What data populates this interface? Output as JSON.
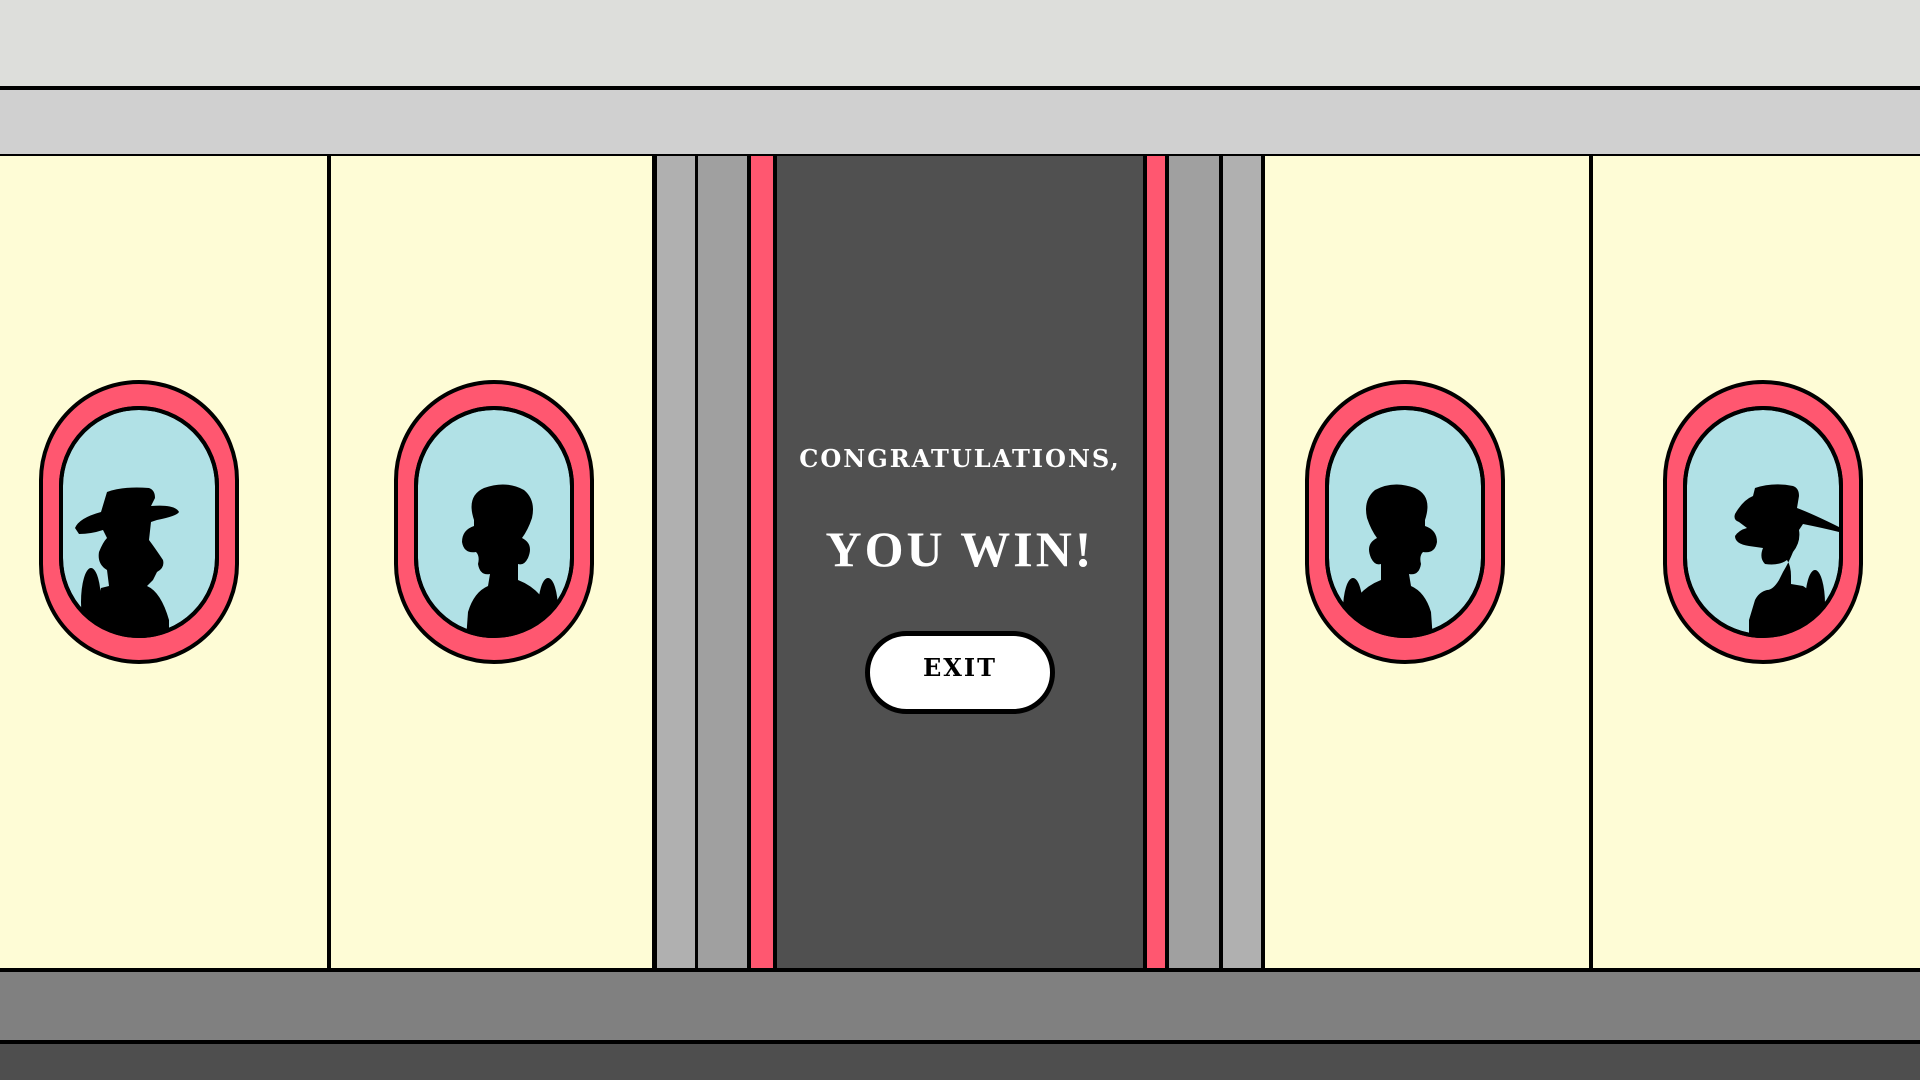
{
  "game": {
    "message_line1": "CONGRATULATIONS,",
    "message_line2": "YOU WIN!",
    "exit_label": "EXIT"
  },
  "colors": {
    "wall": "#fefcd6",
    "window_frame": "#ff5770",
    "window_glass": "#b1e1e6",
    "door": "#505050",
    "door_trim": "#ff5770",
    "floor": "#808080",
    "ceiling": "#d0d0d0"
  },
  "windows": [
    {
      "passenger": "cowboy-hat-silhouette",
      "facing": "left"
    },
    {
      "passenger": "bald-man-silhouette",
      "facing": "left"
    },
    {
      "passenger": "bald-man-silhouette",
      "facing": "right"
    },
    {
      "passenger": "cowboy-hat-silhouette",
      "facing": "left"
    }
  ]
}
